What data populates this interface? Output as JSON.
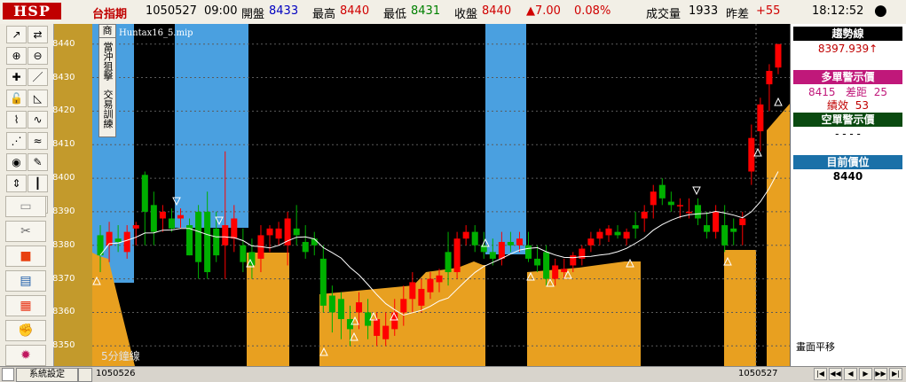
{
  "top": {
    "logo": "HSP",
    "symbol": "台指期",
    "date": "1050527",
    "time": "09:00",
    "open_label": "開盤",
    "open": "8433",
    "high_label": "最高",
    "high": "8440",
    "low_label": "最低",
    "low": "8431",
    "close_label": "收盤",
    "close": "8440",
    "change": "▲7.00",
    "change_pct": "0.08%",
    "volume_label": "成交量",
    "volume": "1933",
    "diff_label": "昨差",
    "diff": "+55",
    "clock": "18:12:52",
    "close_btn": "●"
  },
  "toolbar": {
    "buttons": [
      {
        "icon": "line-tool-icon",
        "glyph": "↗"
      },
      {
        "icon": "split-icon",
        "glyph": "⇄"
      },
      {
        "icon": "zoom-in-icon",
        "glyph": "⊕"
      },
      {
        "icon": "zoom-out-icon",
        "glyph": "⊖"
      },
      {
        "icon": "crosshair-icon",
        "glyph": "✚"
      },
      {
        "icon": "pen-icon",
        "glyph": "／"
      },
      {
        "icon": "lock-icon",
        "glyph": "🔓"
      },
      {
        "icon": "ruler-icon",
        "glyph": "◺"
      },
      {
        "icon": "chart-icon",
        "glyph": "⌇"
      },
      {
        "icon": "wave-icon",
        "glyph": "∿"
      },
      {
        "icon": "fan-icon",
        "glyph": "⋰"
      },
      {
        "icon": "cross-wave-icon",
        "glyph": "≈"
      },
      {
        "icon": "globe-icon",
        "glyph": "◉"
      },
      {
        "icon": "edit-icon",
        "glyph": "✎"
      },
      {
        "icon": "arrows-icon",
        "glyph": "⇕"
      },
      {
        "icon": "candles-icon",
        "glyph": "┃"
      },
      {
        "icon": "color-icon",
        "glyph": ""
      },
      {
        "icon": "refresh-icon",
        "glyph": "↻"
      }
    ],
    "big": [
      {
        "icon": "folder-icon",
        "glyph": "▭"
      },
      {
        "icon": "tools-icon",
        "glyph": "✂"
      },
      {
        "icon": "stop-icon",
        "glyph": "■"
      },
      {
        "icon": "report-icon",
        "glyph": "▤"
      },
      {
        "icon": "grid-icon",
        "glyph": "▦"
      },
      {
        "icon": "gloves-icon",
        "glyph": "✊"
      },
      {
        "icon": "burst-icon",
        "glyph": "✹"
      }
    ]
  },
  "mip": {
    "title": "Huntax16_5.mip",
    "badge1": "商",
    "text1": "當沖狙擊",
    "text2": "交易訓練"
  },
  "chart_label": "5分鐘線",
  "system_btn": "系統設定",
  "dates": {
    "d1": "1050526",
    "d2": "1050527"
  },
  "right_panel": {
    "trend_title": "趨勢線",
    "trend_value": "8397.939↑",
    "long_title": "多單警示價",
    "long_price": "8415",
    "gap_label": "差距",
    "gap": "25",
    "perf_label": "績效",
    "perf": "53",
    "short_title": "空單警示價",
    "short_value": "- - - -",
    "pos_title": "目前價位",
    "pos_value": "8440",
    "shift_label": "畫面平移"
  },
  "nav": [
    "|◀",
    "◀◀",
    "◀",
    "▶",
    "▶▶",
    "▶|"
  ],
  "colors": {
    "up": "#ff0000",
    "down": "#00b000",
    "orange": "#e8a020",
    "blue": "#4aa0e0",
    "bg": "#000000"
  },
  "chart_data": {
    "type": "candlestick",
    "ylim": [
      8344,
      8446
    ],
    "yticks": [
      8350,
      8360,
      8370,
      8380,
      8390,
      8400,
      8410,
      8420,
      8430,
      8440
    ],
    "candles": [
      [
        8383,
        8386,
        8372,
        8377
      ],
      [
        8380,
        8387,
        8375,
        8384
      ],
      [
        8382,
        8386,
        8378,
        8381
      ],
      [
        8378,
        8386,
        8376,
        8384
      ],
      [
        8385,
        8387,
        8380,
        8386
      ],
      [
        8401,
        8402,
        8380,
        8390
      ],
      [
        8392,
        8396,
        8380,
        8384
      ],
      [
        8388,
        8392,
        8384,
        8390
      ],
      [
        8388,
        8391,
        8384,
        8385
      ],
      [
        8388,
        8391,
        8385,
        8389
      ],
      [
        8386,
        8388,
        8377,
        8377
      ],
      [
        8390,
        8392,
        8370,
        8375
      ],
      [
        8390,
        8396,
        8370,
        8372
      ],
      [
        8385,
        8390,
        8375,
        8377
      ],
      [
        8380,
        8408,
        8370,
        8386
      ],
      [
        8382,
        8392,
        8378,
        8388
      ],
      [
        8380,
        8385,
        8372,
        8375
      ],
      [
        8378,
        8382,
        8370,
        8374
      ],
      [
        8376,
        8386,
        8372,
        8383
      ],
      [
        8383,
        8386,
        8378,
        8385
      ],
      [
        8382,
        8387,
        8380,
        8385
      ],
      [
        8380,
        8390,
        8374,
        8388
      ],
      [
        8385,
        8392,
        8380,
        8383
      ],
      [
        8381,
        8386,
        8376,
        8378
      ],
      [
        8382,
        8384,
        8377,
        8380
      ],
      [
        8376,
        8380,
        8360,
        8362
      ],
      [
        8365,
        8368,
        8354,
        8360
      ],
      [
        8364,
        8366,
        8352,
        8358
      ],
      [
        8358,
        8362,
        8350,
        8355
      ],
      [
        8360,
        8366,
        8355,
        8363
      ],
      [
        8360,
        8364,
        8352,
        8356
      ],
      [
        8353,
        8360,
        8350,
        8358
      ],
      [
        8352,
        8360,
        8350,
        8356
      ],
      [
        8355,
        8364,
        8353,
        8360
      ],
      [
        8360,
        8368,
        8356,
        8364
      ],
      [
        8364,
        8372,
        8360,
        8369
      ],
      [
        8362,
        8370,
        8360,
        8367
      ],
      [
        8366,
        8372,
        8364,
        8370
      ],
      [
        8369,
        8373,
        8366,
        8371
      ],
      [
        8378,
        8384,
        8368,
        8372
      ],
      [
        8372,
        8384,
        8370,
        8382
      ],
      [
        8382,
        8386,
        8380,
        8384
      ],
      [
        8384,
        8386,
        8378,
        8380
      ],
      [
        8380,
        8384,
        8376,
        8378
      ],
      [
        8378,
        8382,
        8374,
        8376
      ],
      [
        8376,
        8384,
        8374,
        8381
      ],
      [
        8381,
        8384,
        8378,
        8380
      ],
      [
        8380,
        8384,
        8378,
        8382
      ],
      [
        8380,
        8384,
        8375,
        8376
      ],
      [
        8376,
        8380,
        8372,
        8374
      ],
      [
        8378,
        8380,
        8368,
        8370
      ],
      [
        8370,
        8376,
        8368,
        8374
      ],
      [
        8372,
        8376,
        8370,
        8373
      ],
      [
        8374,
        8378,
        8372,
        8377
      ],
      [
        8376,
        8380,
        8374,
        8379
      ],
      [
        8380,
        8384,
        8378,
        8382
      ],
      [
        8382,
        8385,
        8380,
        8384
      ],
      [
        8383,
        8386,
        8381,
        8385
      ],
      [
        8384,
        8386,
        8382,
        8383
      ],
      [
        8382,
        8385,
        8380,
        8384
      ],
      [
        8386,
        8390,
        8382,
        8385
      ],
      [
        8388,
        8392,
        8384,
        8390
      ],
      [
        8392,
        8398,
        8388,
        8396
      ],
      [
        8398,
        8400,
        8392,
        8394
      ],
      [
        8393,
        8396,
        8390,
        8392
      ],
      [
        8392,
        8394,
        8388,
        8392
      ],
      [
        8390,
        8394,
        8388,
        8390
      ],
      [
        8392,
        8394,
        8386,
        8388
      ],
      [
        8386,
        8390,
        8382,
        8384
      ],
      [
        8384,
        8392,
        8382,
        8390
      ],
      [
        8386,
        8392,
        8378,
        8380
      ],
      [
        8385,
        8388,
        8380,
        8384
      ],
      [
        8386,
        8390,
        8380,
        8388
      ],
      [
        8402,
        8416,
        8398,
        8412
      ],
      [
        8414,
        8424,
        8408,
        8422
      ],
      [
        8428,
        8434,
        8420,
        8432
      ],
      [
        8433,
        8440,
        8431,
        8440
      ]
    ]
  }
}
